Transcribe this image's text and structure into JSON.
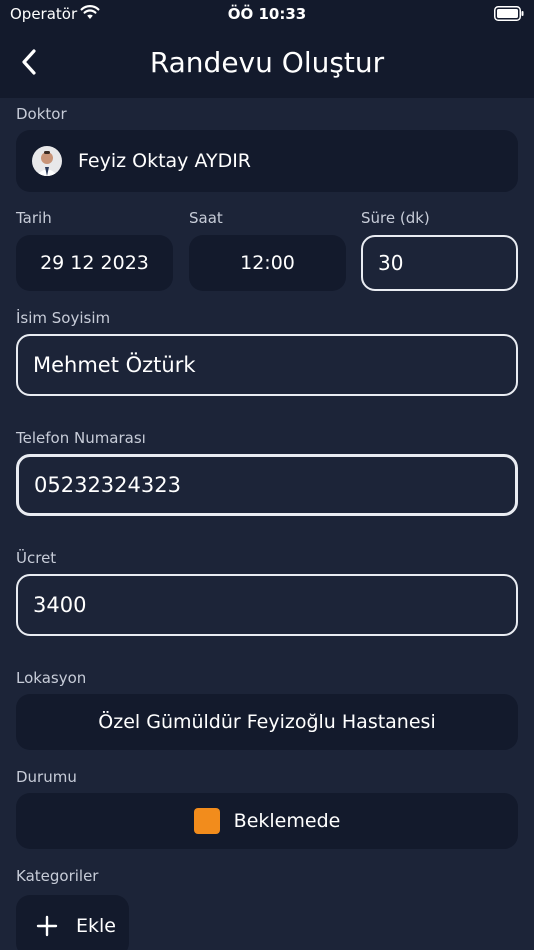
{
  "status_bar": {
    "carrier": "Operatör",
    "time": "ÖÖ 10:33"
  },
  "nav": {
    "title": "Randevu Oluştur"
  },
  "doctor": {
    "label": "Doktor",
    "name": "Feyiz Oktay AYDIR"
  },
  "date": {
    "label": "Tarih",
    "value": "29 12 2023"
  },
  "time": {
    "label": "Saat",
    "value": "12:00"
  },
  "duration": {
    "label": "Süre (dk)",
    "value": "30"
  },
  "full_name": {
    "label": "İsim Soyisim",
    "value": "Mehmet Öztürk"
  },
  "phone": {
    "label": "Telefon Numarası",
    "value": "05232324323"
  },
  "fee": {
    "label": "Ücret",
    "value": "3400"
  },
  "location": {
    "label": "Lokasyon",
    "value": "Özel Gümüldür Feyizoğlu Hastanesi"
  },
  "status": {
    "label": "Durumu",
    "value": "Beklemede",
    "color": "#f28c1c"
  },
  "categories": {
    "label": "Kategoriler",
    "add_label": "Ekle"
  },
  "icons": {
    "back": "chevron-left-icon",
    "wifi": "wifi-icon",
    "battery": "battery-icon",
    "add": "plus-icon",
    "avatar": "doctor-avatar"
  }
}
